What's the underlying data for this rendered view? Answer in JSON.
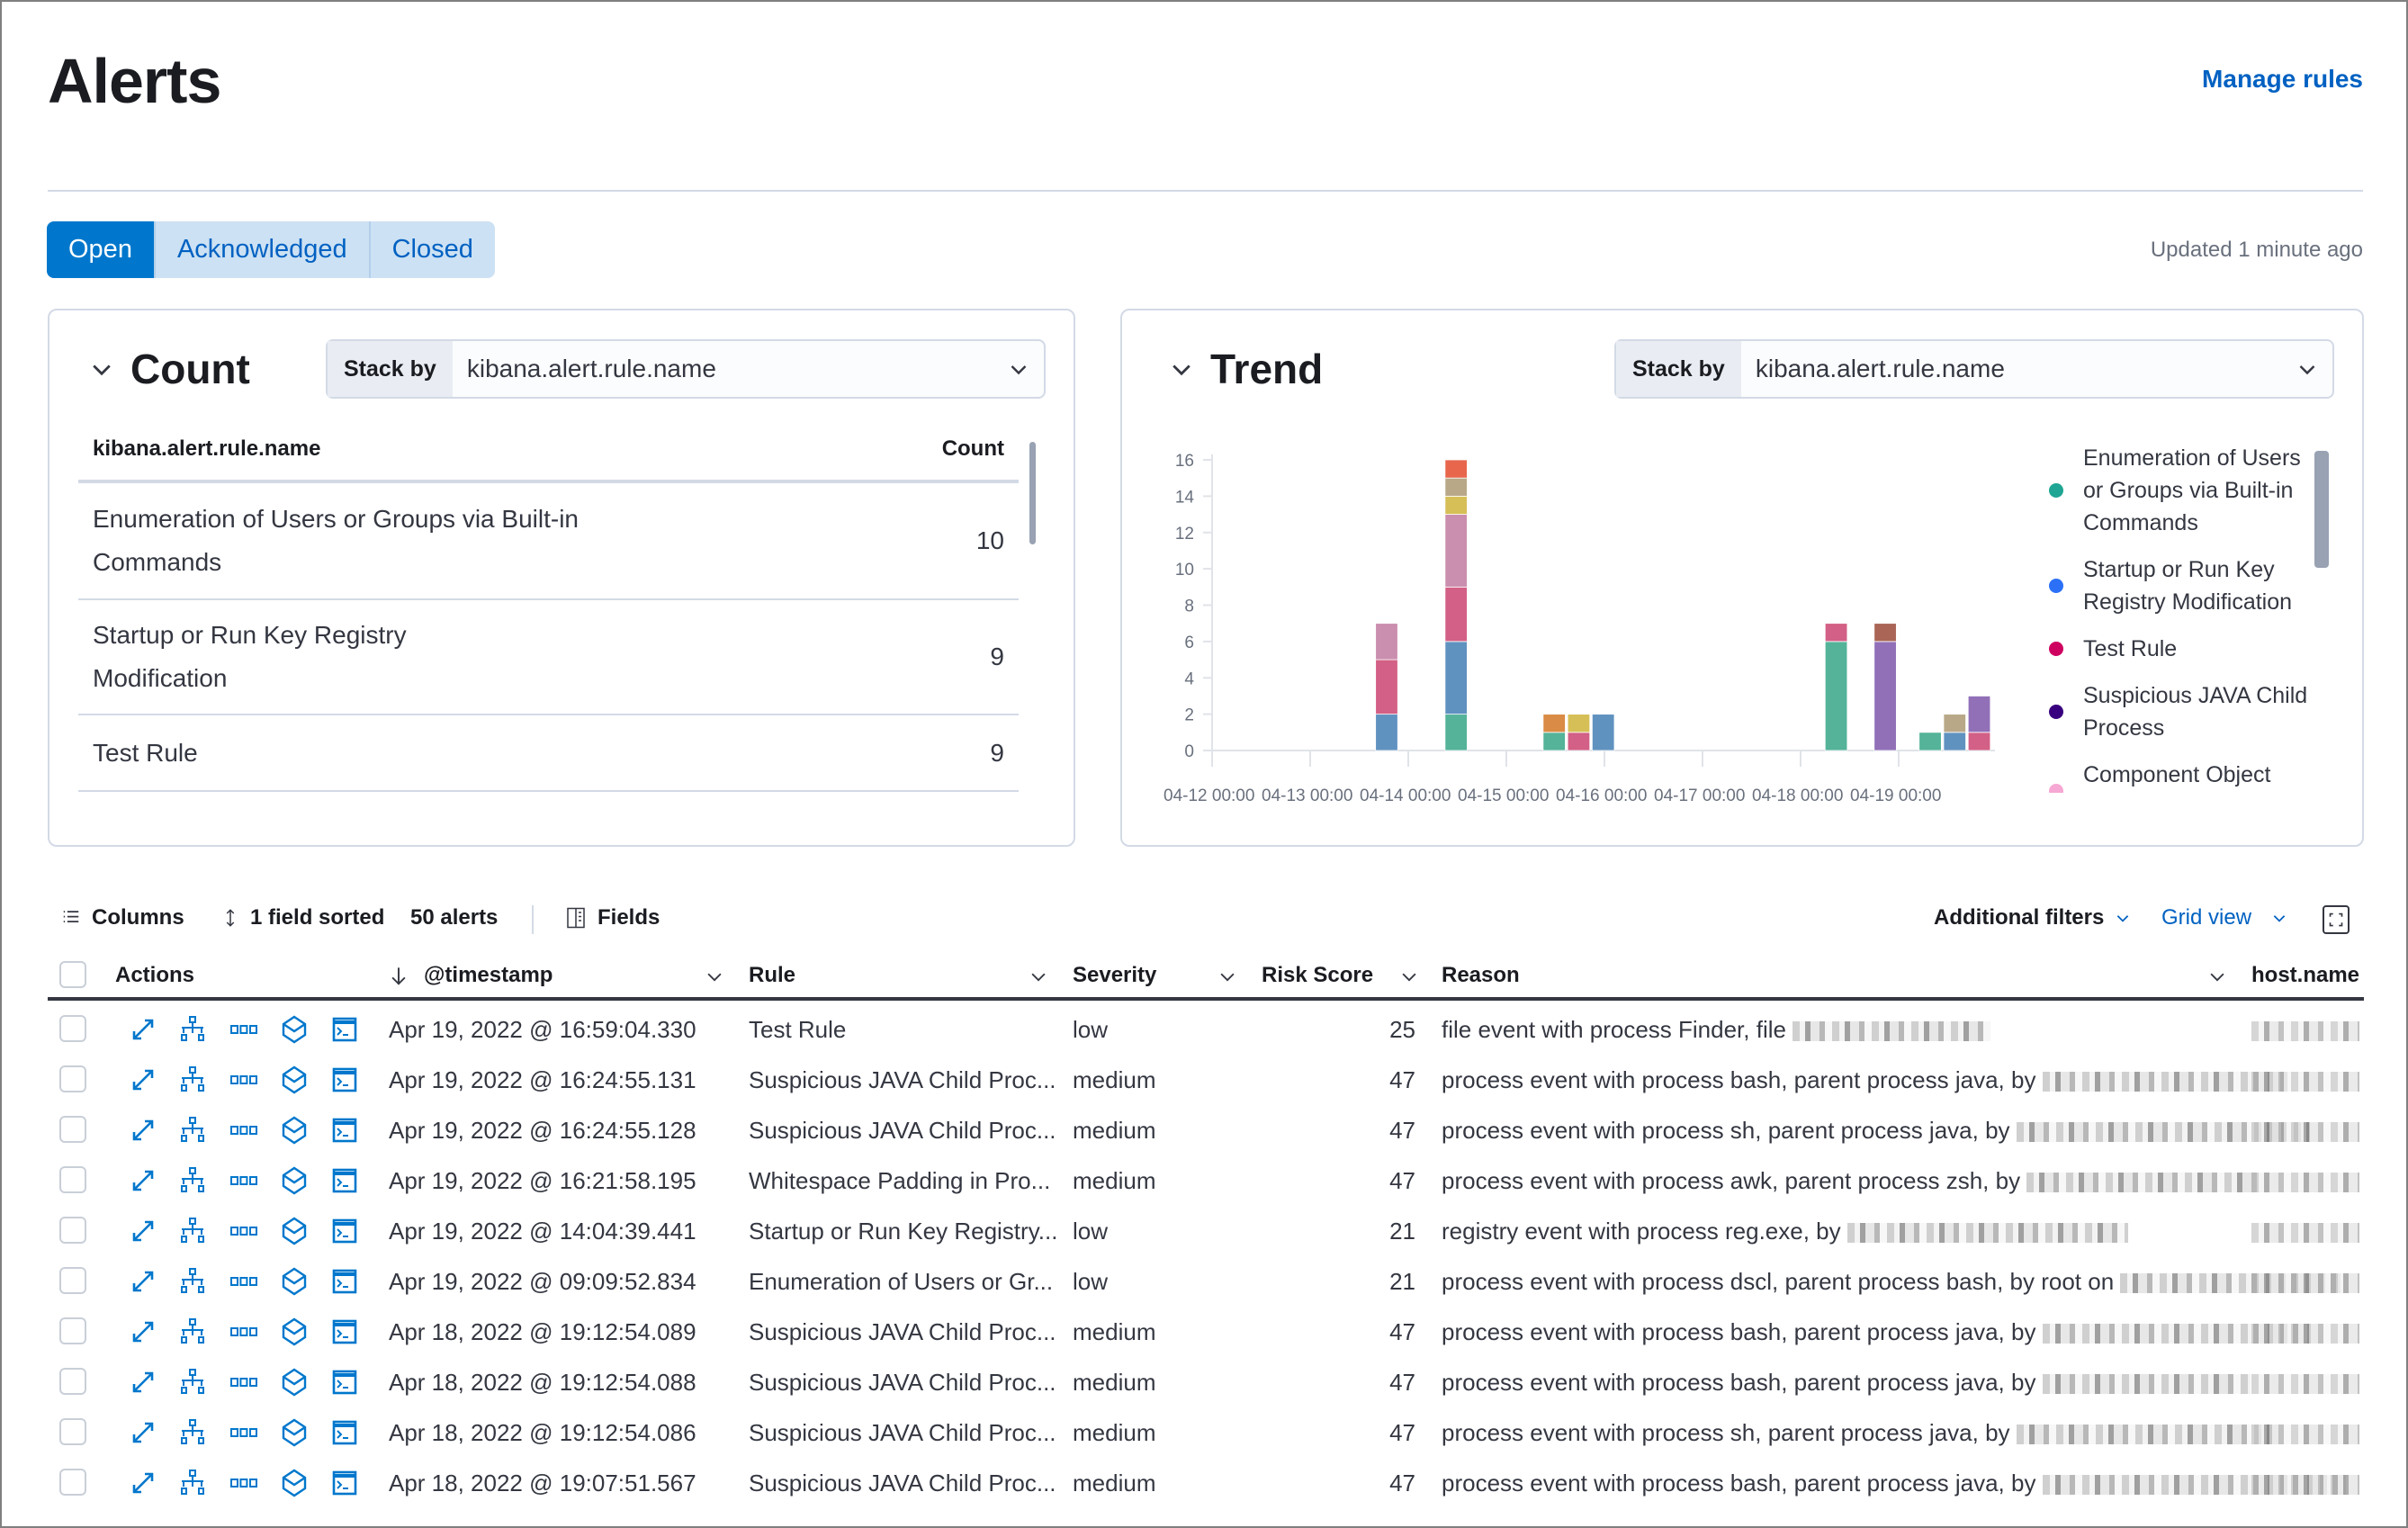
{
  "header": {
    "title": "Alerts",
    "manage_rules": "Manage rules",
    "updated": "Updated 1 minute ago"
  },
  "status_tabs": [
    {
      "label": "Open",
      "active": true
    },
    {
      "label": "Acknowledged",
      "active": false
    },
    {
      "label": "Closed",
      "active": false
    }
  ],
  "count_panel": {
    "title": "Count",
    "stack_by_label": "Stack by",
    "stack_by_value": "kibana.alert.rule.name",
    "columns": [
      "kibana.alert.rule.name",
      "Count"
    ],
    "rows": [
      {
        "name": "Enumeration of Users or Groups via Built-in Commands",
        "count": "10"
      },
      {
        "name": "Startup or Run Key Registry Modification",
        "count": "9"
      },
      {
        "name": "Test Rule",
        "count": "9"
      }
    ]
  },
  "trend_panel": {
    "title": "Trend",
    "stack_by_label": "Stack by",
    "stack_by_value": "kibana.alert.rule.name"
  },
  "chart_data": {
    "type": "bar",
    "stacked": true,
    "grid": false,
    "legend_position": "right",
    "ylim": [
      0,
      16
    ],
    "yticks": [
      "0",
      "2",
      "4",
      "6",
      "8",
      "10",
      "12",
      "14",
      "16"
    ],
    "xticks": [
      "04-12 00:00",
      "04-13 00:00",
      "04-14 00:00",
      "04-15 00:00",
      "04-16 00:00",
      "04-17 00:00",
      "04-18 00:00",
      "04-19 00:00"
    ],
    "x": [
      "04-13 16:00",
      "04-14 09:00",
      "04-15 09:00",
      "04-15 15:00",
      "04-15 21:00",
      "04-18 06:00",
      "04-18 18:00",
      "04-19 05:00",
      "04-19 11:00",
      "04-19 17:00"
    ],
    "series": [
      {
        "name": "Enumeration of Users or Groups via Built-in Commands",
        "color": "#54b399",
        "legend_color": "#1ea593",
        "values": [
          0,
          2,
          1,
          0,
          0,
          6,
          0,
          1,
          0,
          0
        ]
      },
      {
        "name": "Startup or Run Key Registry Modification",
        "color": "#6092c0",
        "legend_color": "#2b70f7",
        "values": [
          2,
          4,
          0,
          0,
          2,
          0,
          0,
          0,
          1,
          0
        ]
      },
      {
        "name": "Test Rule",
        "color": "#d36086",
        "legend_color": "#ce0060",
        "values": [
          3,
          3,
          0,
          1,
          0,
          1,
          0,
          0,
          0,
          1
        ]
      },
      {
        "name": "Suspicious JAVA Child Process",
        "color": "#9170b8",
        "legend_color": "#38007e",
        "values": [
          0,
          0,
          0,
          0,
          0,
          0,
          6,
          0,
          0,
          2
        ]
      },
      {
        "name": "Component Object Model Hijacking",
        "color": "#ca8eae",
        "legend_color": "#f7a7d4",
        "values": [
          2,
          4,
          0,
          0,
          0,
          0,
          0,
          0,
          0,
          0
        ]
      },
      {
        "color": "#da8b45",
        "values": [
          0,
          0,
          1,
          0,
          0,
          0,
          0,
          0,
          0,
          0
        ]
      },
      {
        "color": "#d6bf57",
        "values": [
          0,
          1,
          0,
          1,
          0,
          0,
          0,
          0,
          0,
          0
        ]
      },
      {
        "color": "#b9a888",
        "values": [
          0,
          1,
          0,
          0,
          0,
          0,
          0,
          0,
          1,
          0
        ]
      },
      {
        "color": "#aa6556",
        "values": [
          0,
          0,
          0,
          0,
          0,
          0,
          1,
          0,
          0,
          0
        ]
      },
      {
        "color": "#e7664c",
        "values": [
          0,
          1,
          0,
          0,
          0,
          0,
          0,
          0,
          0,
          0
        ]
      }
    ]
  },
  "toolbar": {
    "columns": "Columns",
    "sorted": "1 field sorted",
    "alerts": "50 alerts",
    "fields": "Fields",
    "additional_filters": "Additional filters",
    "grid_view": "Grid view"
  },
  "table": {
    "headers": {
      "actions": "Actions",
      "timestamp": "@timestamp",
      "rule": "Rule",
      "severity": "Severity",
      "risk": "Risk Score",
      "reason": "Reason",
      "host": "host.name"
    },
    "rows": [
      {
        "timestamp": "Apr 19, 2022 @ 16:59:04.330",
        "rule": "Test Rule",
        "severity": "low",
        "risk": "25",
        "reason": "file event with process Finder, file"
      },
      {
        "timestamp": "Apr 19, 2022 @ 16:24:55.131",
        "rule": "Suspicious JAVA Child Proc...",
        "severity": "medium",
        "risk": "47",
        "reason": "process event with process bash, parent process java, by"
      },
      {
        "timestamp": "Apr 19, 2022 @ 16:24:55.128",
        "rule": "Suspicious JAVA Child Proc...",
        "severity": "medium",
        "risk": "47",
        "reason": "process event with process sh, parent process java, by"
      },
      {
        "timestamp": "Apr 19, 2022 @ 16:21:58.195",
        "rule": "Whitespace Padding in Pro...",
        "severity": "medium",
        "risk": "47",
        "reason": "process event with process awk, parent process zsh, by"
      },
      {
        "timestamp": "Apr 19, 2022 @ 14:04:39.441",
        "rule": "Startup or Run Key Registry...",
        "severity": "low",
        "risk": "21",
        "reason": "registry event with process reg.exe, by"
      },
      {
        "timestamp": "Apr 19, 2022 @ 09:09:52.834",
        "rule": "Enumeration of Users or Gr...",
        "severity": "low",
        "risk": "21",
        "reason": "process event with process dscl, parent process bash, by root on"
      },
      {
        "timestamp": "Apr 18, 2022 @ 19:12:54.089",
        "rule": "Suspicious JAVA Child Proc...",
        "severity": "medium",
        "risk": "47",
        "reason": "process event with process bash, parent process java, by"
      },
      {
        "timestamp": "Apr 18, 2022 @ 19:12:54.088",
        "rule": "Suspicious JAVA Child Proc...",
        "severity": "medium",
        "risk": "47",
        "reason": "process event with process bash, parent process java, by"
      },
      {
        "timestamp": "Apr 18, 2022 @ 19:12:54.086",
        "rule": "Suspicious JAVA Child Proc...",
        "severity": "medium",
        "risk": "47",
        "reason": "process event with process sh, parent process java, by"
      },
      {
        "timestamp": "Apr 18, 2022 @ 19:07:51.567",
        "rule": "Suspicious JAVA Child Proc...",
        "severity": "medium",
        "risk": "47",
        "reason": "process event with process bash, parent process java, by"
      }
    ]
  }
}
